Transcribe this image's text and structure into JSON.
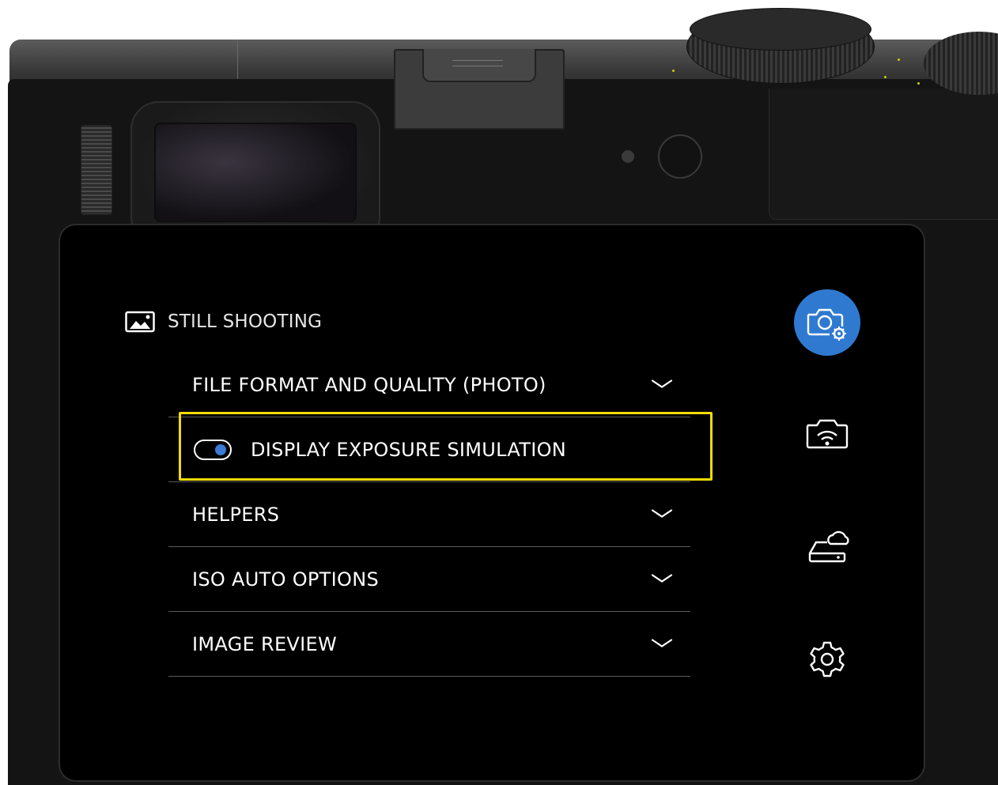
{
  "colors": {
    "accent": "#2f7ad0",
    "highlight": "#f2dc00",
    "dial_marks": "#c8d400",
    "text": "#ffffff"
  },
  "header": {
    "icon": "image-icon",
    "title": "STILL SHOOTING"
  },
  "menu": {
    "items": [
      {
        "label": "FILE FORMAT AND QUALITY (PHOTO)",
        "type": "expandable",
        "icon": "chevron-down-icon"
      },
      {
        "label": "DISPLAY EXPOSURE SIMULATION",
        "type": "toggle",
        "toggle_on": true,
        "highlighted": true
      },
      {
        "label": "HELPERS",
        "type": "expandable",
        "icon": "chevron-down-icon"
      },
      {
        "label": "ISO AUTO OPTIONS",
        "type": "expandable",
        "icon": "chevron-down-icon"
      },
      {
        "label": "IMAGE REVIEW",
        "type": "expandable",
        "icon": "chevron-down-icon"
      }
    ]
  },
  "side_tabs": [
    {
      "icon": "camera-settings-icon",
      "active": true
    },
    {
      "icon": "camera-wifi-icon",
      "active": false
    },
    {
      "icon": "storage-cloud-icon",
      "active": false
    },
    {
      "icon": "gear-icon",
      "active": false
    }
  ]
}
